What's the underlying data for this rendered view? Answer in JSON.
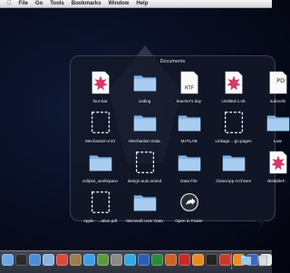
{
  "menubar": {
    "items": [
      "File",
      "Go",
      "Tools",
      "Bookmarks",
      "Window",
      "Help"
    ]
  },
  "stack": {
    "title": "Documents",
    "items": [
      {
        "label": "four-bar",
        "icon": "mathematica-doc-icon"
      },
      {
        "label": "coding",
        "icon": "folder-icon"
      },
      {
        "label": "teacher's day",
        "icon": "rtf-doc-icon"
      },
      {
        "label": "Untitled-1.nb",
        "icon": "mathematica-doc-icon"
      },
      {
        "label": "subscrib",
        "icon": "pdf-doc-icon"
      },
      {
        "label": "Mechanism.mrd",
        "icon": "generic-doc-icon"
      },
      {
        "label": "Mechanism Data",
        "icon": "folder-icon"
      },
      {
        "label": "MATLAB",
        "icon": "folder-icon"
      },
      {
        "label": "Linkage ...gn.pages",
        "icon": "generic-doc-icon"
      },
      {
        "label": "Lear",
        "icon": "folder-icon"
      },
      {
        "label": "eclipse_workspace",
        "icon": "folder-icon"
      },
      {
        "label": "design auto.xmind",
        "icon": "generic-doc-icon"
      },
      {
        "label": "Data File",
        "icon": "folder-icon"
      },
      {
        "label": "CleanApp Archives",
        "icon": "folder-icon"
      },
      {
        "label": "BistableF...",
        "icon": "mathematica-doc-icon"
      },
      {
        "label": "Apple - ...ation.pdf",
        "icon": "generic-doc-icon"
      },
      {
        "label": "Microsoft User Data",
        "icon": "folder-icon"
      },
      {
        "label": "Open in Finder",
        "icon": "open-in-finder-icon"
      }
    ]
  },
  "dock": {
    "icons": [
      "finder-icon",
      "dashboard-icon",
      "safari-icon",
      "mail-icon",
      "ical-icon",
      "address-book-icon",
      "itunes-icon",
      "iphoto-icon",
      "preferences-icon",
      "skype-icon",
      "word-icon",
      "excel-icon",
      "powerpoint-icon",
      "mathematica-icon",
      "matlab-icon",
      "terminal-icon",
      "calendar-icon",
      "vlc-icon",
      "xcode-icon",
      "textedit-icon"
    ],
    "colors": [
      "#6aa6e8",
      "#2a2a2a",
      "#4a8fd6",
      "#8ab4e0",
      "#d94a3a",
      "#9c7c4a",
      "#3ea0e8",
      "#5a9a3c",
      "#8a8a8a",
      "#34a8e0",
      "#2a5fb8",
      "#2a8a3c",
      "#d0602a",
      "#c82a2a",
      "#e88a2a",
      "#222",
      "#c83a2a",
      "#f08a1a",
      "#3a6ab8",
      "#e8e8e8"
    ]
  }
}
